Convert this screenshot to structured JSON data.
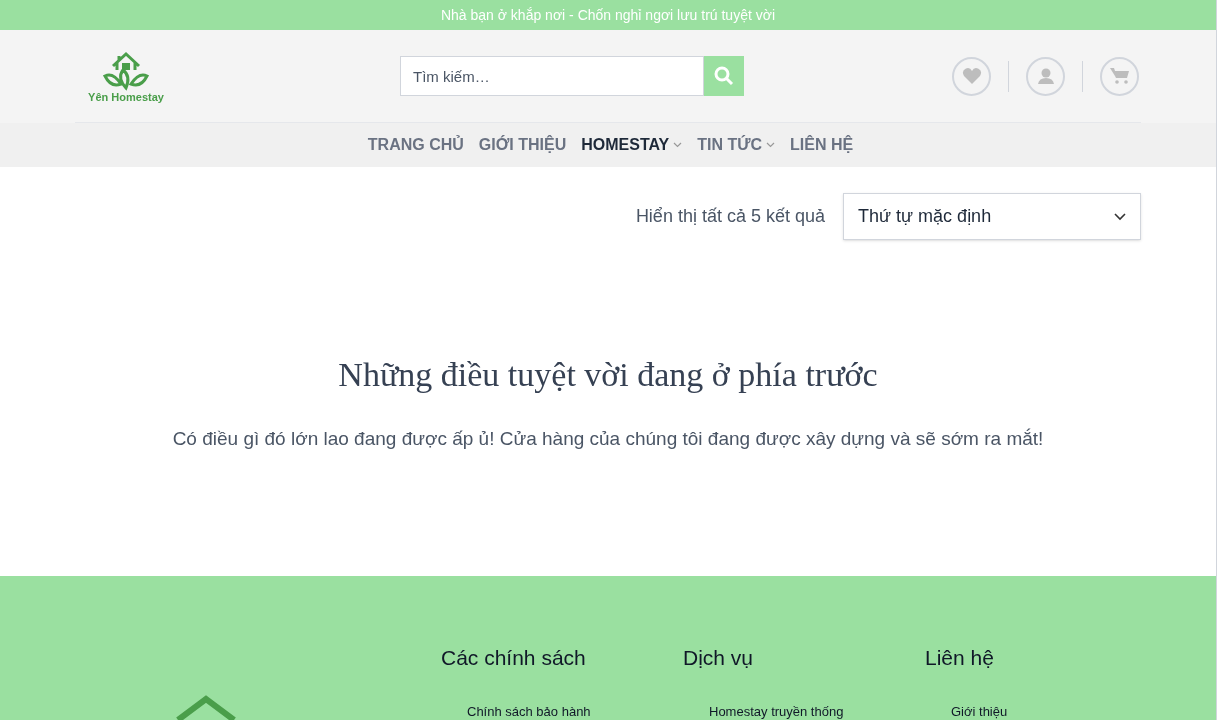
{
  "top_bar": {
    "text": "Nhà bạn ở khắp nơi - Chốn nghỉ ngơi lưu trú tuyệt vời"
  },
  "header": {
    "logo_text": "Yên Homestay",
    "search": {
      "placeholder": "Tìm kiếm…"
    }
  },
  "nav": [
    {
      "label": "TRANG CHỦ",
      "selected": false,
      "dropdown": false
    },
    {
      "label": "GIỚI THIỆU",
      "selected": false,
      "dropdown": false
    },
    {
      "label": "HOMESTAY",
      "selected": true,
      "dropdown": true
    },
    {
      "label": "TIN TỨC",
      "selected": false,
      "dropdown": true
    },
    {
      "label": "LIÊN HỆ",
      "selected": false,
      "dropdown": false
    }
  ],
  "results": {
    "count_text": "Hiển thị tất cả 5 kết quả",
    "sort": "Thứ tự mặc định"
  },
  "notice": {
    "title": "Những điều tuyệt vời đang ở phía trước",
    "text": "Có điều gì đó lớn lao đang được ấp ủ! Cửa hàng của chúng tôi đang được xây dựng và sẽ sớm ra mắt!"
  },
  "footer": {
    "columns": [
      {
        "heading": "Các chính sách",
        "links": [
          "Chính sách bảo hành"
        ]
      },
      {
        "heading": "Dịch vụ",
        "links": [
          "Homestay truyền thống"
        ]
      },
      {
        "heading": "Liên hệ",
        "links": [
          "Giới thiệu"
        ]
      }
    ]
  }
}
